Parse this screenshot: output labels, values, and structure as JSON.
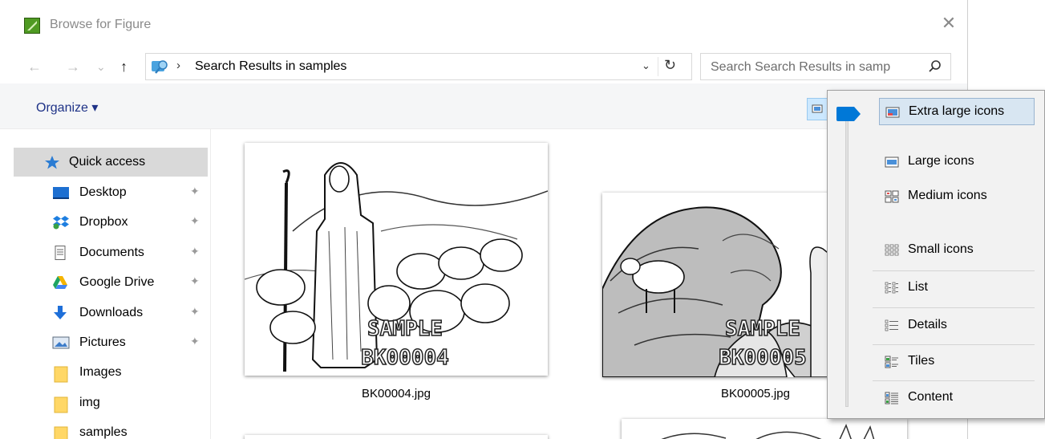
{
  "window": {
    "title": "Browse for Figure",
    "close_symbol": "✕"
  },
  "nav": {
    "back_symbol": "←",
    "forward_symbol": "→",
    "recent_symbol": "⌄",
    "up_symbol": "↑"
  },
  "address": {
    "separator": "›",
    "location": "Search Results in samples",
    "dropdown_symbol": "⌄",
    "refresh_symbol": "↻"
  },
  "search": {
    "placeholder": "Search Search Results in samp"
  },
  "toolbar": {
    "organize_label": "Organize ▾"
  },
  "sidebar": {
    "items": [
      {
        "label": "Quick access",
        "icon": "star-icon",
        "pinned": false,
        "selected": true
      },
      {
        "label": "Desktop",
        "icon": "desktop-icon",
        "pinned": true
      },
      {
        "label": "Dropbox",
        "icon": "dropbox-icon",
        "pinned": true
      },
      {
        "label": "Documents",
        "icon": "document-icon",
        "pinned": true
      },
      {
        "label": "Google Drive",
        "icon": "google-drive-icon",
        "pinned": true
      },
      {
        "label": "Downloads",
        "icon": "download-arrow-icon",
        "pinned": true
      },
      {
        "label": "Pictures",
        "icon": "pictures-icon",
        "pinned": true
      },
      {
        "label": "Images",
        "icon": "folder-icon",
        "pinned": false
      },
      {
        "label": "img",
        "icon": "folder-icon",
        "pinned": false
      },
      {
        "label": "samples",
        "icon": "folder-icon",
        "pinned": false
      }
    ],
    "pin_symbol": "✦"
  },
  "files": [
    {
      "name": "BK00004.jpg",
      "watermark_line1": "SAMPLE",
      "watermark_line2": "BK00004"
    },
    {
      "name": "BK00005.jpg",
      "watermark_line1": "SAMPLE",
      "watermark_line2": "BK00005"
    }
  ],
  "view_menu": {
    "items": [
      {
        "label": "Extra large icons",
        "icon": "extra-large-icons-icon",
        "active": true
      },
      {
        "label": "Large icons",
        "icon": "large-icons-icon"
      },
      {
        "label": "Medium icons",
        "icon": "medium-icons-icon"
      },
      {
        "label": "Small icons",
        "icon": "small-icons-icon"
      },
      {
        "label": "List",
        "icon": "list-icon"
      },
      {
        "label": "Details",
        "icon": "details-icon"
      },
      {
        "label": "Tiles",
        "icon": "tiles-icon"
      },
      {
        "label": "Content",
        "icon": "content-icon"
      }
    ],
    "accent_color": "#0078d7"
  }
}
